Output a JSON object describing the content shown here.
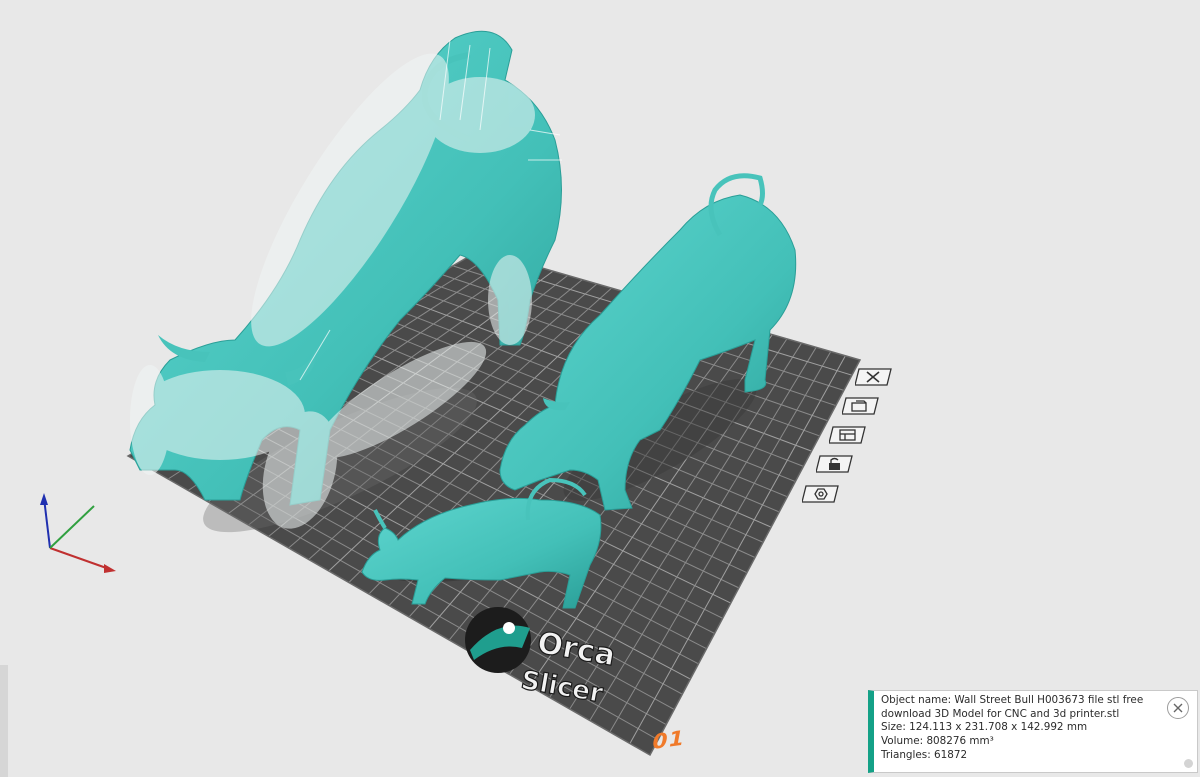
{
  "viewport": {
    "logo": {
      "line1": "Orca",
      "line2": "Slicer"
    },
    "plate_number": "01"
  },
  "plate_toolbar": {
    "items": [
      {
        "icon": "close-icon"
      },
      {
        "icon": "auto-orient-icon"
      },
      {
        "icon": "arrange-icon"
      },
      {
        "icon": "lock-icon"
      },
      {
        "icon": "settings-icon"
      }
    ]
  },
  "object_info": {
    "name_line1": "Object name: Wall Street Bull H003673 file stl free",
    "name_line2": "download 3D Model for CNC and 3d printer.stl",
    "size": "Size: 124.113 x 231.708 x 142.992 mm",
    "volume": "Volume: 808276 mm³",
    "triangles": "Triangles: 61872"
  },
  "colors": {
    "background": "#e8e8e8",
    "plate": "#4a4a4a",
    "plate_grid": "#8a8a8a",
    "model": "#4ac7c0",
    "model_dark": "#2e9f98",
    "support": "#eef4f3",
    "accent": "#14a187",
    "plate_label": "#f07a2a"
  }
}
